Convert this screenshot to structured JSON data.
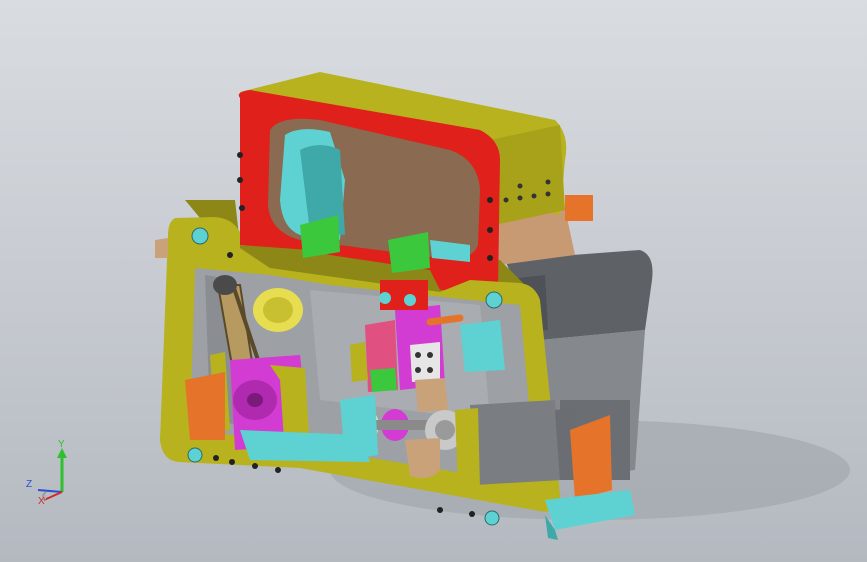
{
  "viewport": {
    "background_top": "#d9dde1",
    "background_bottom": "#b4b9c0"
  },
  "model": {
    "part_colors": {
      "frame": "#b8b21e",
      "frame_dark": "#8c8716",
      "top_bracket": "#e0201a",
      "motor_grey": "#6f7377",
      "base_plate": "#5ed2d2",
      "magenta": "#d23cd2",
      "green": "#3cc83c",
      "orange": "#e8782a",
      "tan": "#c9a27a"
    }
  },
  "triad": {
    "y_label": "Y",
    "z_label": "Z",
    "x_label": "X",
    "y_color": "#2fbf2f",
    "z_color": "#2a4fd0",
    "x_color": "#d02a2a"
  }
}
